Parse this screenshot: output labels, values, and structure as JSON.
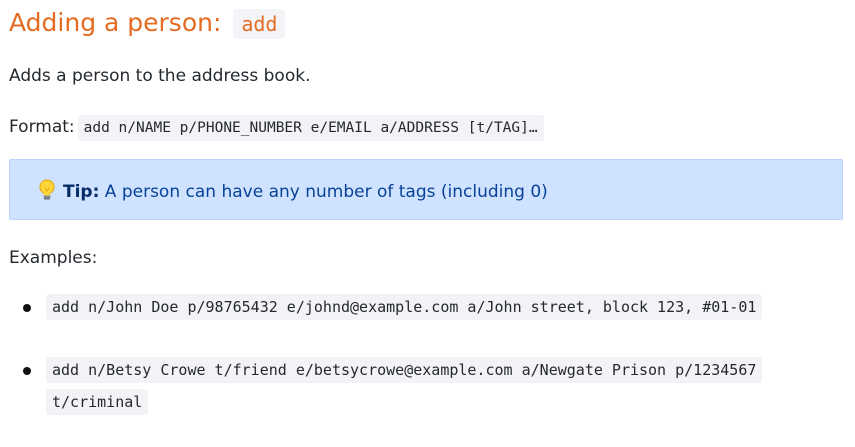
{
  "heading": {
    "text": "Adding a person:",
    "code": "add"
  },
  "description": "Adds a person to the address book.",
  "format": {
    "label": "Format:",
    "code": "add n/NAME p/PHONE_NUMBER e/EMAIL a/ADDRESS [t/TAG]…"
  },
  "tip": {
    "icon": "lightbulb-icon",
    "label": "Tip:",
    "text": "A person can have any number of tags (including 0)"
  },
  "examples": {
    "label": "Examples:",
    "items": [
      "add n/John Doe p/98765432 e/johnd@example.com a/John street, block 123, #01-01",
      "add n/Betsy Crowe t/friend e/betsycrowe@example.com a/Newgate Prison p/1234567 t/criminal"
    ]
  }
}
